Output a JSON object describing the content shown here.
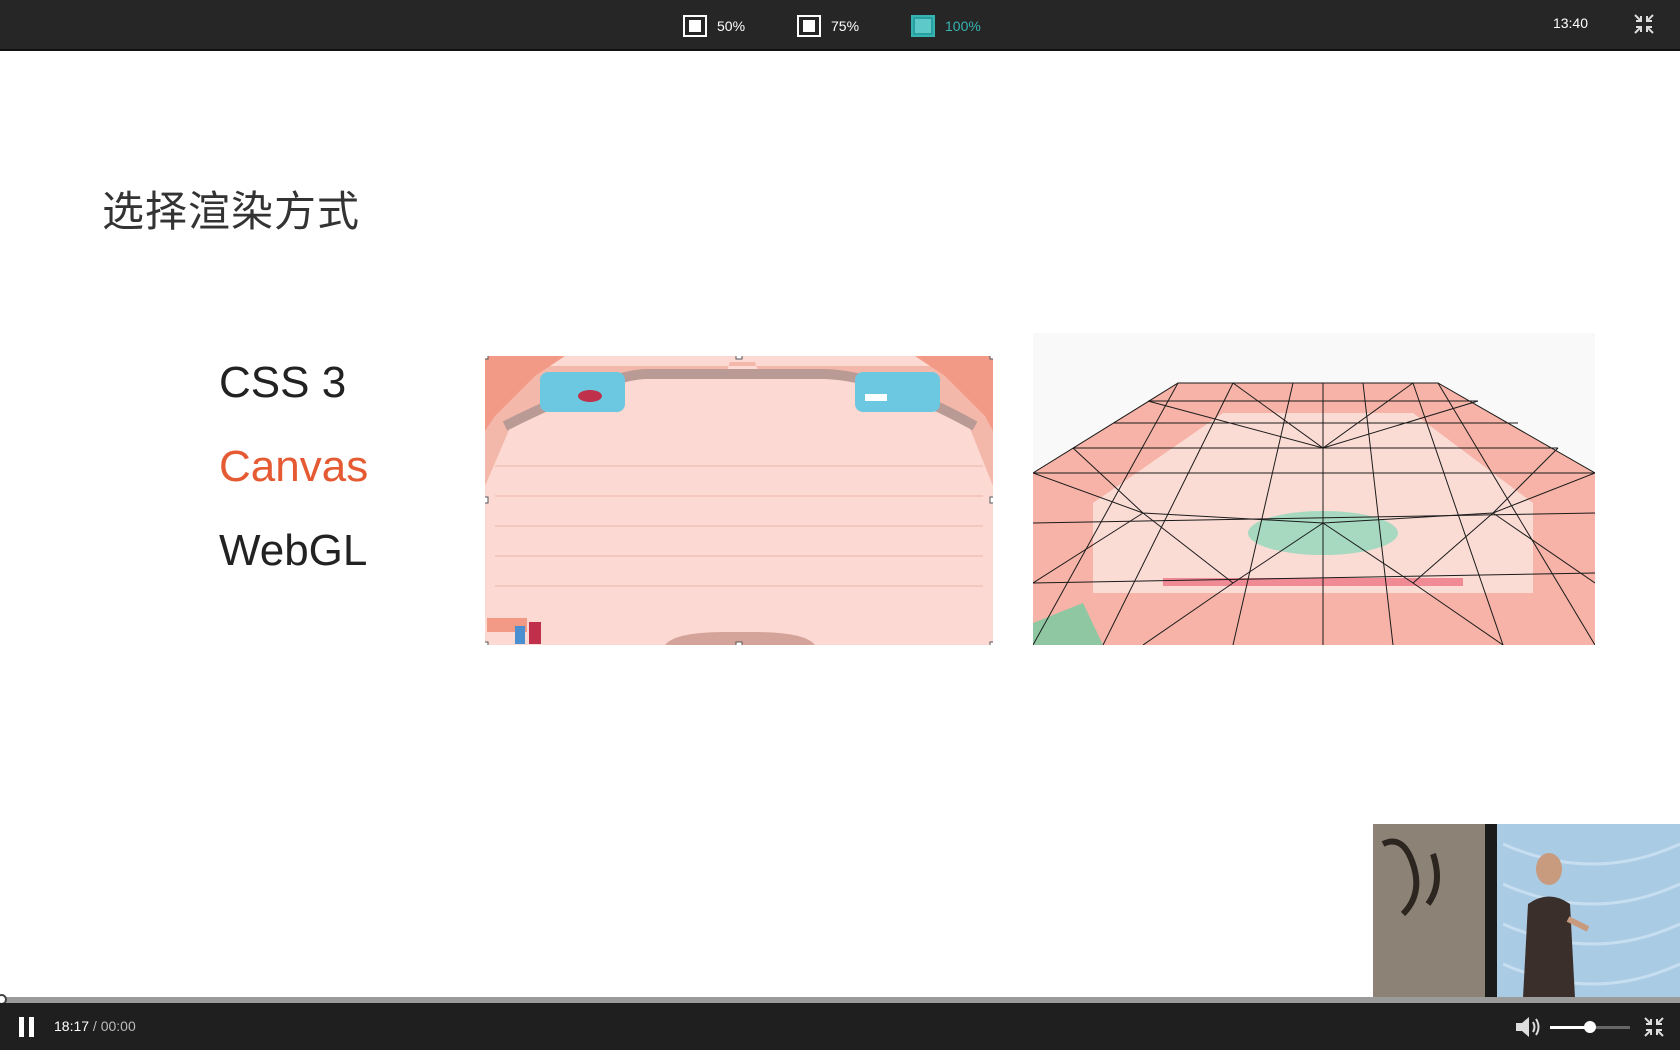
{
  "topbar": {
    "zoom_options": [
      {
        "label": "50%",
        "active": false
      },
      {
        "label": "75%",
        "active": false
      },
      {
        "label": "100%",
        "active": true
      }
    ],
    "clock": "13:40",
    "exit_icon": "exit-fullscreen-icon"
  },
  "slide": {
    "title": "选择渲染方式",
    "options": [
      "CSS 3",
      "Canvas",
      "WebGL"
    ],
    "highlight_color": "#e55a33"
  },
  "player": {
    "progress": 0,
    "current_time": "18:17",
    "separator": " / ",
    "duration": "00:00",
    "volume": 0.5,
    "accent_color": "#36b4b4"
  }
}
